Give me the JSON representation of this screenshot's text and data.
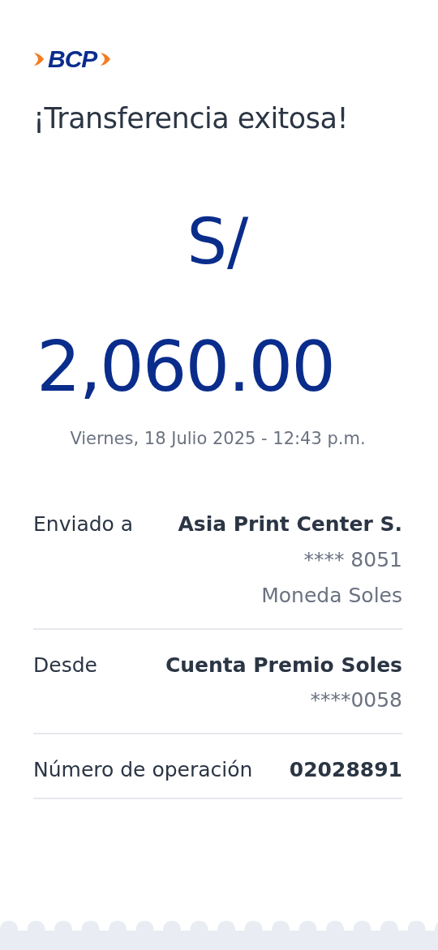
{
  "logo": {
    "text": "BCP"
  },
  "title": "¡Transferencia exitosa!",
  "amount": {
    "currency": "S/",
    "value": "2,060.00"
  },
  "date": "Viernes, 18 Julio 2025 - 12:43 p.m.",
  "details": [
    {
      "label": "Enviado a",
      "lines": [
        {
          "text": "Asia Print Center S.",
          "bold": true
        },
        {
          "text": "**** 8051",
          "bold": false
        },
        {
          "text": "Moneda Soles",
          "bold": false
        }
      ]
    },
    {
      "label": "Desde",
      "lines": [
        {
          "text": "Cuenta Premio Soles",
          "bold": true
        },
        {
          "text": "****0058",
          "bold": false
        }
      ]
    },
    {
      "label": "Número de operación",
      "lines": [
        {
          "text": "02028891",
          "bold": true
        }
      ]
    }
  ]
}
